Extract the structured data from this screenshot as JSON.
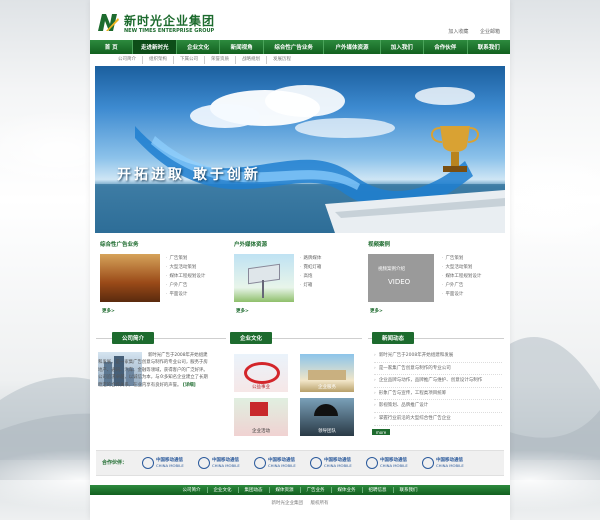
{
  "brand": {
    "name_cn": "新时光企业集团",
    "name_en": "NEW TIMES ENTERPRISE GROUP"
  },
  "top_links": [
    "加入收藏",
    "企业邮箱"
  ],
  "nav": [
    "首 页",
    "走进新时光",
    "企业文化",
    "新闻视角",
    "综合性广告业务",
    "户外媒体资源",
    "加入我们",
    "合作伙伴",
    "联系我们"
  ],
  "subnav": [
    "公司简介",
    "组织架构",
    "下属公司",
    "荣誉资质",
    "战略规划",
    "发展历程"
  ],
  "banner": {
    "slogan": "开拓进取  敢于创新"
  },
  "panels": [
    {
      "title": "综合性广告业务",
      "items": [
        "广告策划",
        "大型活动策划",
        "媒体工程规划设计",
        "户外广告",
        "平面设计"
      ],
      "more": "更多>"
    },
    {
      "title": "户外媒体资源",
      "items": [
        "路牌媒体",
        "霓虹灯箱",
        "高炮",
        "灯箱"
      ],
      "more": "更多>"
    },
    {
      "title": "视频案例",
      "video_title": "视频案例介绍",
      "video_label": "VIDEO",
      "items": [
        "广告策划",
        "大型活动策划",
        "媒体工程规划设计",
        "户外广告",
        "平面设计"
      ],
      "more": "更多>"
    }
  ],
  "about": {
    "title": "公司简介",
    "text": "新时光广告于2008年开始组建和发展，是一家集广告创意与制作的专业公司，服务于房地产、通讯、汽车、金融等领域，获得客户的广泛好评。公司追求卓越，以诚信为本，与众多知名企业建立了长期稳定的合作关系，在业内享有良好的声誉。",
    "more": "[详细]"
  },
  "culture": {
    "title": "企业文化",
    "items": [
      "公益事业",
      "企业服务",
      "企业活动",
      "领导团队"
    ]
  },
  "news": {
    "title": "新闻动态",
    "items": [
      "新时光广告于2008年开始组建和发展",
      "是一家集广告创意与制作的专业公司",
      "企业品牌与动作，品牌推广与维护、创意设计与制作",
      "形象广告与宣传，工程类项目统筹",
      "影视策划、品牌推广设计",
      "掌握行业前沿的大型综合性广告企业"
    ],
    "more": "more"
  },
  "partners": {
    "label": "合作伙伴：",
    "name_cn": "中国移动通信",
    "name_en": "CHINA MOBILE",
    "count": 6
  },
  "footer_nav": [
    "公司简介",
    "企业文化",
    "集团动态",
    "媒体资源",
    "广告业务",
    "媒体业务",
    "招聘信息",
    "联系我们"
  ],
  "copyright": [
    "新时光企业集团",
    "版权所有"
  ]
}
